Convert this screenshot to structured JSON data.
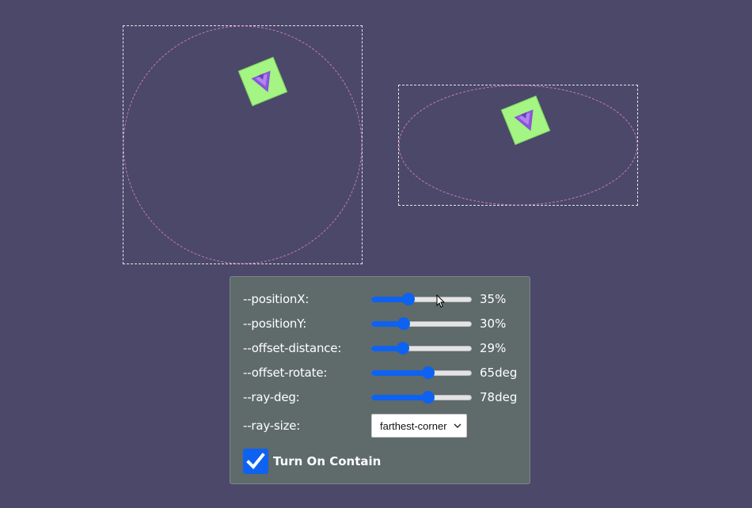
{
  "controls": {
    "position_x": {
      "label": "--positionX:",
      "value_text": "35%",
      "fraction": 0.35
    },
    "position_y": {
      "label": "--positionY:",
      "value_text": "30%",
      "fraction": 0.3
    },
    "offset_distance": {
      "label": "--offset-distance:",
      "value_text": "29%",
      "fraction": 0.29
    },
    "offset_rotate": {
      "label": "--offset-rotate:",
      "value_text": "65deg",
      "fraction": 0.58
    },
    "ray_deg": {
      "label": "--ray-deg:",
      "value_text": "78deg",
      "fraction": 0.58
    },
    "ray_size": {
      "label": "--ray-size:",
      "selected": "farthest-corner"
    },
    "contain": {
      "label": "Turn On Contain",
      "checked": true
    }
  },
  "icons": {
    "tile": "arrow-icon",
    "select_chevron": "chevron-down-icon",
    "checkbox": "checkmark-icon",
    "cursor": "mouse-pointer-icon"
  },
  "colors": {
    "background": "#4b4869",
    "tile": "#a4f583",
    "arrow": "#8a55d6",
    "path_stroke": "#c47ab0",
    "accent": "#0d62f1",
    "panel": "#5f6a6b"
  }
}
